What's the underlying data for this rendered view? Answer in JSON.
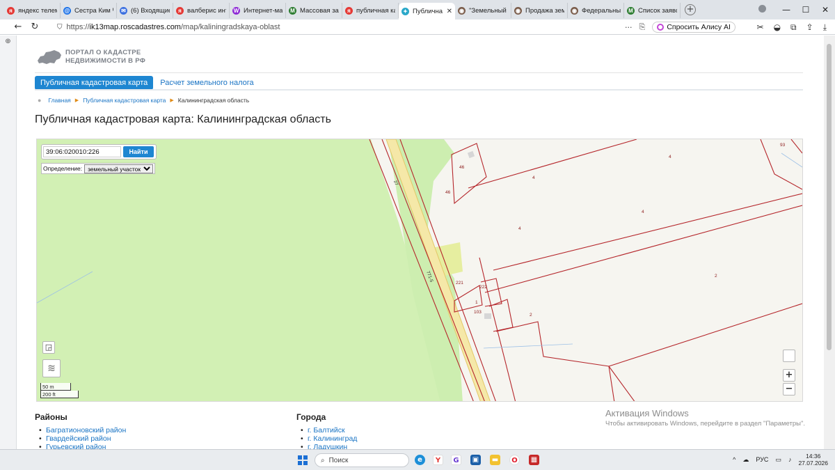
{
  "browser": {
    "tabs": [
      {
        "label": "яндекс телем",
        "color": "#e53935",
        "glyph": "я"
      },
      {
        "label": "Сестра Ким Ч",
        "color": "#1e73e8",
        "glyph": "@"
      },
      {
        "label": "(6) Входящие",
        "color": "#3b6fe0",
        "glyph": "✉"
      },
      {
        "label": "валберис инт",
        "color": "#e53935",
        "glyph": "я"
      },
      {
        "label": "Интернет-ма",
        "color": "#8e2bd6",
        "glyph": "W"
      },
      {
        "label": "Массовая зая",
        "color": "#2e7d32",
        "glyph": "M"
      },
      {
        "label": "публичная ка",
        "color": "#e53935",
        "glyph": "я"
      },
      {
        "label": "Публична",
        "color": "#2aa8c9",
        "glyph": "✦",
        "active": true
      },
      {
        "label": "\"Земельный у",
        "color": "#7a5c4a",
        "glyph": "◉"
      },
      {
        "label": "Продажа зем",
        "color": "#7a5c4a",
        "glyph": "◉"
      },
      {
        "label": "Федеральный",
        "color": "#7a5c4a",
        "glyph": "◉"
      },
      {
        "label": "Список заявс",
        "color": "#2e7d32",
        "glyph": "M"
      }
    ],
    "url_prefix": "https://",
    "url_domain": "ik13map.roscadastres.com",
    "url_path": "/map/kaliningradskaya-oblast",
    "alice_label": "Спросить Алису AI"
  },
  "site": {
    "logo_line1": "ПОРТАЛ О КАДАСТРЕ",
    "logo_line2": "НЕДВИЖИМОСТИ В РФ",
    "nav": [
      {
        "label": "Публичная кадастровая карта",
        "active": true
      },
      {
        "label": "Расчет земельного налога",
        "active": false
      }
    ],
    "breadcrumb": {
      "home": "Главная",
      "section": "Публичная кадастровая карта",
      "current": "Калининградская область"
    },
    "title": "Публичная кадастровая карта: Калининградская область"
  },
  "map": {
    "search_value": "39:06:020010:226",
    "search_button": "Найти",
    "definition_label": "Определение:",
    "definition_value": "земельный участок",
    "road_label_1": "27",
    "road_label_2": "771-5",
    "parcel_labels": [
      "46",
      "46",
      "4",
      "4",
      "4",
      "4",
      "93",
      "221",
      "222",
      "103",
      "1",
      "2",
      "2"
    ],
    "scale_m": "50 m",
    "scale_ft": "200 ft",
    "zoom_in": "+",
    "zoom_out": "−"
  },
  "lists": {
    "districts_title": "Районы",
    "districts": [
      "Багратионовский район",
      "Гвардейский район",
      "Гурьевский район"
    ],
    "cities_title": "Города",
    "cities": [
      "г. Балтийск",
      "г. Калининград",
      "г. Ладушкин"
    ]
  },
  "watermark": {
    "line1": "Активация Windows",
    "line2": "Чтобы активировать Windows, перейдите в раздел \"Параметры\"."
  },
  "taskbar": {
    "search_placeholder": "Поиск",
    "lang": "РУС",
    "time": "14:36",
    "date": "27.07.2026"
  }
}
